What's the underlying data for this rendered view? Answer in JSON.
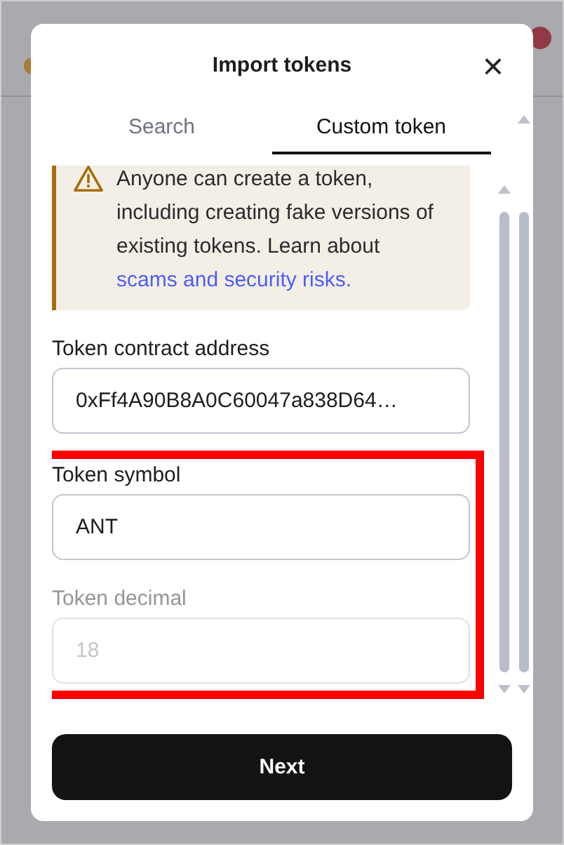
{
  "dialog": {
    "title": "Import tokens",
    "close": "×"
  },
  "tabs": [
    {
      "label": "Search",
      "selected": false
    },
    {
      "label": "Custom token",
      "selected": true
    }
  ],
  "warning": {
    "text": "Anyone can create a token, including creating fake versions of existing tokens. Learn about",
    "link": "scams and security risks."
  },
  "fields": [
    {
      "label": "Token contract address",
      "value": "0xFf4A90B8A0C60047a838D64…",
      "disabled": false,
      "highlighted": false
    },
    {
      "label": "Token symbol",
      "value": "ANT",
      "disabled": false,
      "highlighted": true
    },
    {
      "label": "Token decimal",
      "placeholder": "18",
      "disabled": true,
      "highlighted": true
    }
  ],
  "next_button": "Next"
}
